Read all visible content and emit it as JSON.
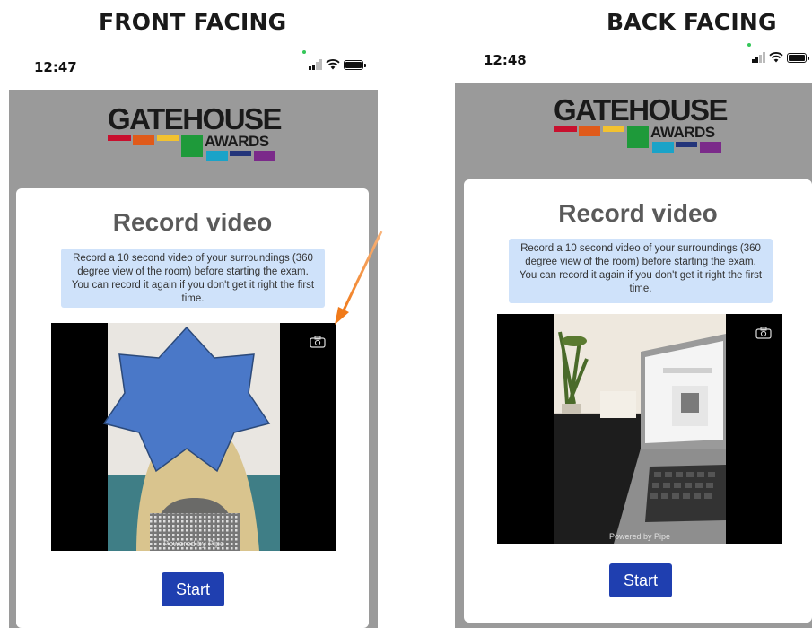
{
  "captions": {
    "left": "FRONT FACING",
    "right": "BACK FACING"
  },
  "screens": {
    "front": {
      "time": "12:47",
      "logo": {
        "main": "GATEHOUSE",
        "sub": "AWARDS"
      },
      "title": "Record video",
      "info": "Record a 10 second video of your surroundings (360 degree view of the room) before starting the exam. You can record it again if you don't get it right the first time.",
      "powered_by": "Powered by Pipe",
      "start_label": "Start"
    },
    "back": {
      "time": "12:48",
      "logo": {
        "main": "GATEHOUSE",
        "sub": "AWARDS"
      },
      "title": "Record video",
      "info": "Record a 10 second video of your surroundings (360 degree view of the room) before starting the exam. You can record it again if you don't get it right the first time.",
      "powered_by": "Powered by Pipe",
      "start_label": "Start"
    }
  },
  "colors": {
    "header_grey": "#9a9a9a",
    "info_blue": "#cfe2fa",
    "start_blue": "#1f3fb0",
    "arrow_orange": "#f07a1a",
    "star_blue": "#4a78c8"
  },
  "icons": [
    "camera-switch-icon",
    "signal-icon",
    "wifi-icon",
    "battery-icon"
  ]
}
